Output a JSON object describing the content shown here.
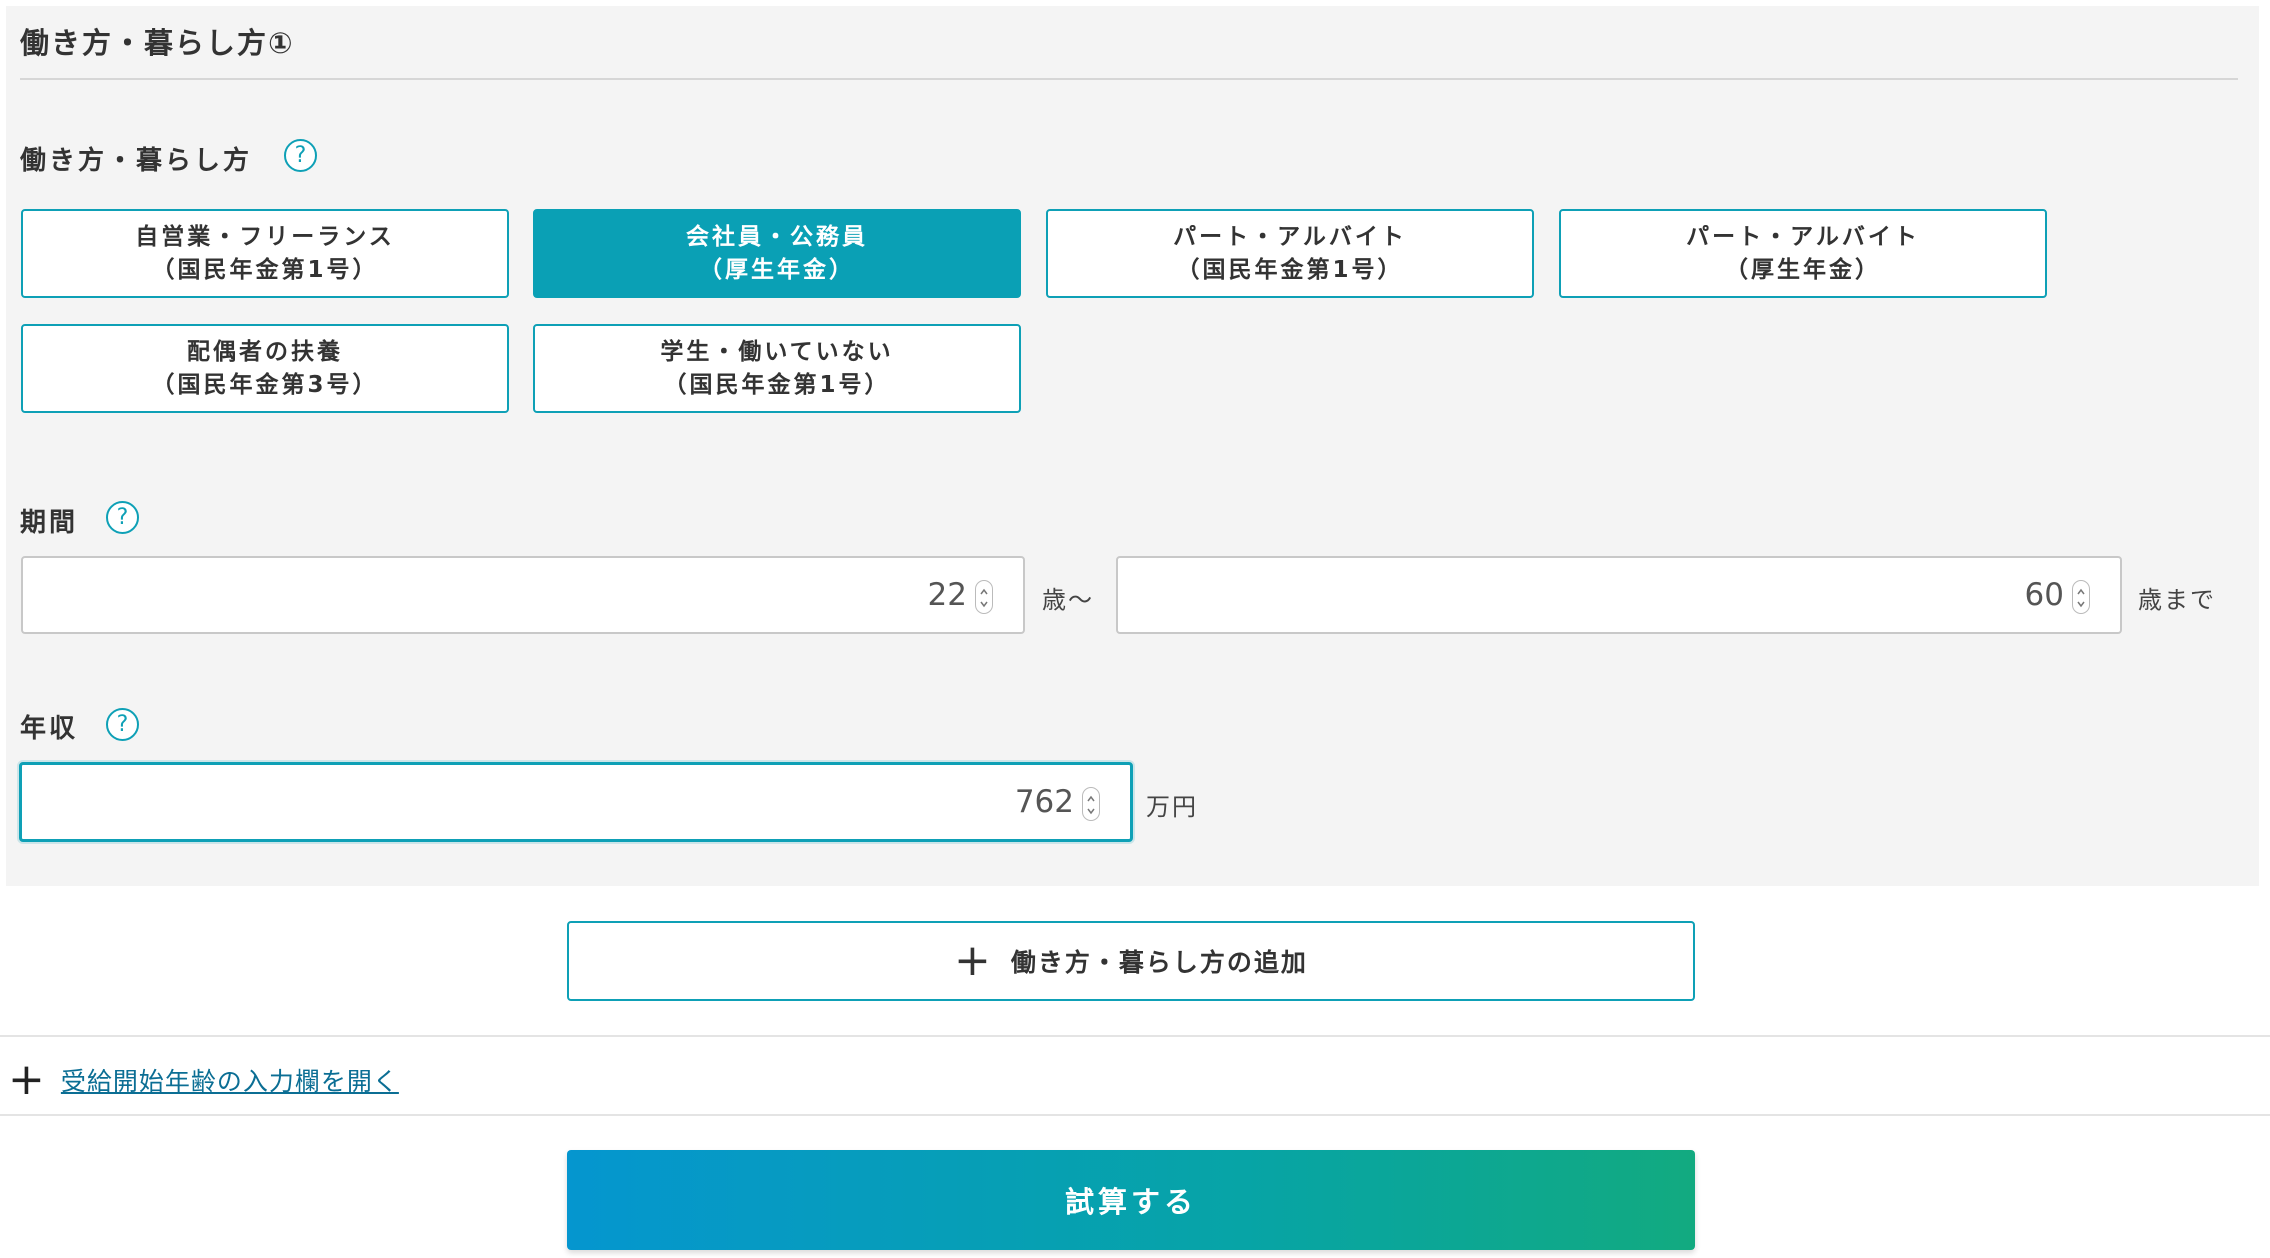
{
  "section": {
    "title": "働き方・暮らし方①"
  },
  "work_style": {
    "label": "働き方・暮らし方",
    "help_icon": "?",
    "options": [
      {
        "line1": "自営業・フリーランス",
        "line2": "（国民年金第1号）",
        "selected": false
      },
      {
        "line1": "会社員・公務員",
        "line2": "（厚生年金）",
        "selected": true
      },
      {
        "line1": "パート・アルバイト",
        "line2": "（国民年金第1号）",
        "selected": false
      },
      {
        "line1": "パート・アルバイト",
        "line2": "（厚生年金）",
        "selected": false
      },
      {
        "line1": "配偶者の扶養",
        "line2": "（国民年金第3号）",
        "selected": false
      },
      {
        "line1": "学生・働いていない",
        "line2": "（国民年金第1号）",
        "selected": false
      }
    ]
  },
  "period": {
    "label": "期間",
    "help_icon": "?",
    "from_value": "22",
    "from_unit": "歳〜",
    "to_value": "60",
    "to_unit": "歳まで"
  },
  "income": {
    "label": "年収",
    "help_icon": "?",
    "value": "762",
    "unit": "万円"
  },
  "add_button": {
    "icon": "plus-icon",
    "label": "働き方・暮らし方の追加"
  },
  "expand_link": {
    "icon": "plus-icon",
    "label": "受給開始年齢の入力欄を開く"
  },
  "submit": {
    "label": "試算する"
  },
  "colors": {
    "accent": "#0ea0b6",
    "selected_bg": "#0aa0b5",
    "panel_bg": "#f4f4f4",
    "submit_gradient_start": "#0596cf",
    "submit_gradient_end": "#12aa80"
  }
}
